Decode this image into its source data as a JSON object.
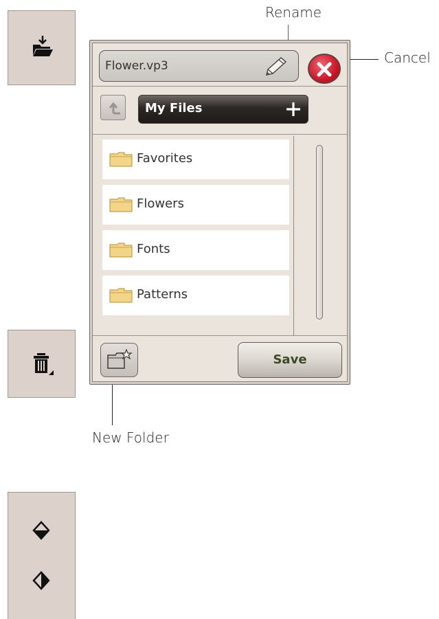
{
  "callouts": {
    "rename": "Rename",
    "cancel": "Cancel",
    "new_folder": "New Folder"
  },
  "dialog": {
    "filename": "Flower.vp3",
    "location": "My Files",
    "items": [
      {
        "label": "Favorites"
      },
      {
        "label": "Flowers"
      },
      {
        "label": "Fonts"
      },
      {
        "label": "Patterns"
      }
    ],
    "save_label": "Save"
  },
  "icons": {
    "side_top": "folder-download-icon",
    "side_middle": "trash-icon",
    "side_bottom_1": "rotate-diamond-horizontal-icon",
    "side_bottom_2": "rotate-diamond-vertical-icon",
    "pencil": "pencil-icon",
    "cancel": "close-icon",
    "up": "folder-up-icon",
    "plus": "plus-icon",
    "folder": "folder-icon",
    "new_folder": "new-folder-icon"
  },
  "colors": {
    "tile_bg": "#ddd1cc",
    "dialog_bg": "#ebe4dc",
    "cancel_red": "#c9192a",
    "location_bar": "#2c2826",
    "folder_yellow": "#f3d58a",
    "save_text": "#3b4a24"
  }
}
